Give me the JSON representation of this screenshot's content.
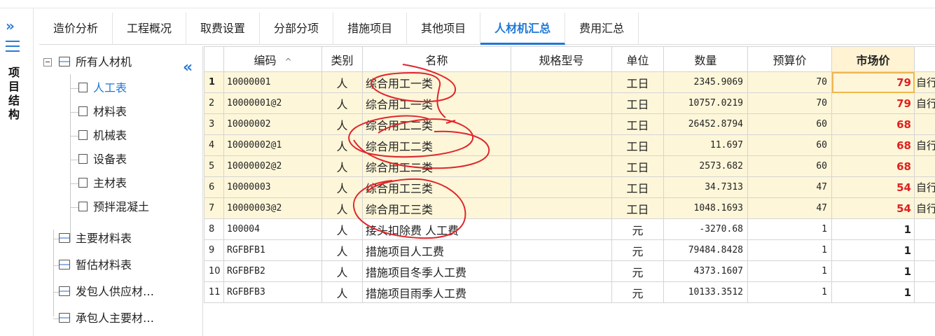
{
  "left_bar": {
    "vertical_title": [
      "项",
      "目",
      "结",
      "构"
    ]
  },
  "tabs": [
    {
      "label": "造价分析",
      "active": false
    },
    {
      "label": "工程概况",
      "active": false
    },
    {
      "label": "取费设置",
      "active": false
    },
    {
      "label": "分部分项",
      "active": false
    },
    {
      "label": "措施项目",
      "active": false
    },
    {
      "label": "其他项目",
      "active": false
    },
    {
      "label": "人材机汇总",
      "active": true
    },
    {
      "label": "费用汇总",
      "active": false
    }
  ],
  "tree": {
    "root": "所有人材机",
    "children": [
      "人工表",
      "材料表",
      "机械表",
      "设备表",
      "主材表",
      "预拌混凝土"
    ],
    "selected": "人工表",
    "others": [
      "主要材料表",
      "暂估材料表",
      "发包人供应材…",
      "承包人主要材…"
    ]
  },
  "grid": {
    "headers": [
      "",
      "编码",
      "类别",
      "名称",
      "规格型号",
      "单位",
      "数量",
      "预算价",
      "市场价",
      ""
    ],
    "rows": [
      {
        "idx": "1",
        "code": "10000001",
        "type": "人",
        "name": "综合用工一类",
        "spec": "",
        "unit": "工日",
        "qty": "2345.9069",
        "budget": "70",
        "market": "79",
        "extra": "自行"
      },
      {
        "idx": "2",
        "code": "10000001@2",
        "type": "人",
        "name": "综合用工一类",
        "spec": "",
        "unit": "工日",
        "qty": "10757.0219",
        "budget": "70",
        "market": "79",
        "extra": "自行"
      },
      {
        "idx": "3",
        "code": "10000002",
        "type": "人",
        "name": "综合用工二类",
        "spec": "",
        "unit": "工日",
        "qty": "26452.8794",
        "budget": "60",
        "market": "68",
        "extra": ""
      },
      {
        "idx": "4",
        "code": "10000002@1",
        "type": "人",
        "name": "综合用工二类",
        "spec": "",
        "unit": "工日",
        "qty": "11.697",
        "budget": "60",
        "market": "68",
        "extra": "自行"
      },
      {
        "idx": "5",
        "code": "10000002@2",
        "type": "人",
        "name": "综合用工二类",
        "spec": "",
        "unit": "工日",
        "qty": "2573.682",
        "budget": "60",
        "market": "68",
        "extra": ""
      },
      {
        "idx": "6",
        "code": "10000003",
        "type": "人",
        "name": "综合用工三类",
        "spec": "",
        "unit": "工日",
        "qty": "34.7313",
        "budget": "47",
        "market": "54",
        "extra": "自行"
      },
      {
        "idx": "7",
        "code": "10000003@2",
        "type": "人",
        "name": "综合用工三类",
        "spec": "",
        "unit": "工日",
        "qty": "1048.1693",
        "budget": "47",
        "market": "54",
        "extra": "自行"
      },
      {
        "idx": "8",
        "code": "100004",
        "type": "人",
        "name": "接头扣除费 人工费",
        "spec": "",
        "unit": "元",
        "qty": "-3270.68",
        "budget": "1",
        "market": "1",
        "extra": ""
      },
      {
        "idx": "9",
        "code": "RGFBFB1",
        "type": "人",
        "name": "措施项目人工费",
        "spec": "",
        "unit": "元",
        "qty": "79484.8428",
        "budget": "1",
        "market": "1",
        "extra": ""
      },
      {
        "idx": "10",
        "code": "RGFBFB2",
        "type": "人",
        "name": "措施项目冬季人工费",
        "spec": "",
        "unit": "元",
        "qty": "4373.1607",
        "budget": "1",
        "market": "1",
        "extra": ""
      },
      {
        "idx": "11",
        "code": "RGFBFB3",
        "type": "人",
        "name": "措施项目雨季人工费",
        "spec": "",
        "unit": "元",
        "qty": "10133.3512",
        "budget": "1",
        "market": "1",
        "extra": ""
      }
    ]
  },
  "colors": {
    "accent": "#1e78d7",
    "highlight_row": "#fdf6d9",
    "market_red": "#e02020",
    "ink": "#e0262b"
  }
}
